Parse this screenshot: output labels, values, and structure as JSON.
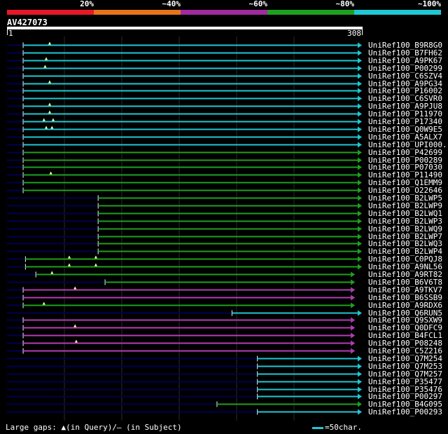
{
  "legend": {
    "labels": [
      "20%",
      "~40%",
      "~60%",
      "~80%",
      "~100%"
    ],
    "colors": [
      "#e8182a",
      "#e8741a",
      "#a02aa0",
      "#1ea01e",
      "#1ec8d2"
    ]
  },
  "query": {
    "name": "AV427073",
    "start": "1",
    "end": "308"
  },
  "colors": {
    "cyan": "#1ec8d2",
    "green": "#1ea01e",
    "magenta": "#b43cb4",
    "navy": "#000050",
    "gap_line": "#3a3a3a"
  },
  "hits": [
    {
      "name": "UniRef100_B9R8G0",
      "color": "cyan",
      "start": 15,
      "end": 308,
      "gaps": [
        38
      ]
    },
    {
      "name": "UniRef100_B7FH62",
      "color": "cyan",
      "start": 15,
      "end": 308,
      "gaps": []
    },
    {
      "name": "UniRef100_A9PK67",
      "color": "cyan",
      "start": 15,
      "end": 308,
      "gaps": [
        35
      ]
    },
    {
      "name": "UniRef100_P00299",
      "color": "cyan",
      "start": 15,
      "end": 308,
      "gaps": [
        34
      ]
    },
    {
      "name": "UniRef100_C6SZV4",
      "color": "cyan",
      "start": 15,
      "end": 308,
      "gaps": []
    },
    {
      "name": "UniRef100_A9PG34",
      "color": "cyan",
      "start": 15,
      "end": 308,
      "gaps": [
        38
      ]
    },
    {
      "name": "UniRef100_P16002",
      "color": "cyan",
      "start": 15,
      "end": 308,
      "gaps": []
    },
    {
      "name": "UniRef100_C6SVR0",
      "color": "cyan",
      "start": 15,
      "end": 308,
      "gaps": []
    },
    {
      "name": "UniRef100_A9PJU8",
      "color": "cyan",
      "start": 15,
      "end": 308,
      "gaps": [
        38
      ]
    },
    {
      "name": "UniRef100_P11970",
      "color": "cyan",
      "start": 15,
      "end": 308,
      "gaps": [
        38
      ]
    },
    {
      "name": "UniRef100_P17340",
      "color": "cyan",
      "start": 15,
      "end": 308,
      "gaps": [
        33,
        41
      ]
    },
    {
      "name": "UniRef100_Q0W9E5",
      "color": "cyan",
      "start": 15,
      "end": 308,
      "gaps": [
        35,
        40
      ]
    },
    {
      "name": "UniRef100_A5ALX7",
      "color": "cyan",
      "start": 15,
      "end": 308,
      "gaps": []
    },
    {
      "name": "UniRef100_UPI000...",
      "color": "cyan",
      "start": 15,
      "end": 308,
      "gaps": []
    },
    {
      "name": "UniRef100_P42699",
      "color": "green",
      "start": 15,
      "end": 308,
      "gaps": []
    },
    {
      "name": "UniRef100_P00289",
      "color": "green",
      "start": 15,
      "end": 308,
      "gaps": []
    },
    {
      "name": "UniRef100_P07030",
      "color": "green",
      "start": 15,
      "end": 308,
      "gaps": []
    },
    {
      "name": "UniRef100_P11490",
      "color": "green",
      "start": 15,
      "end": 308,
      "gaps": [
        39
      ]
    },
    {
      "name": "UniRef100_Q1EMM9",
      "color": "green",
      "start": 15,
      "end": 308,
      "gaps": []
    },
    {
      "name": "UniRef100_O22646",
      "color": "green",
      "start": 15,
      "end": 308,
      "gaps": []
    },
    {
      "name": "UniRef100_B2LWP5",
      "color": "green",
      "start": 80,
      "end": 308,
      "gaps": []
    },
    {
      "name": "UniRef100_B2LWP9",
      "color": "green",
      "start": 80,
      "end": 308,
      "gaps": []
    },
    {
      "name": "UniRef100_B2LWQ1",
      "color": "green",
      "start": 80,
      "end": 308,
      "gaps": []
    },
    {
      "name": "UniRef100_B2LWP3",
      "color": "green",
      "start": 80,
      "end": 308,
      "gaps": []
    },
    {
      "name": "UniRef100_B2LWQ9",
      "color": "green",
      "start": 80,
      "end": 308,
      "gaps": []
    },
    {
      "name": "UniRef100_B2LWP7",
      "color": "green",
      "start": 80,
      "end": 308,
      "gaps": []
    },
    {
      "name": "UniRef100_B2LWQ3",
      "color": "green",
      "start": 80,
      "end": 308,
      "gaps": []
    },
    {
      "name": "UniRef100_B2LWP4",
      "color": "green",
      "start": 80,
      "end": 308,
      "gaps": []
    },
    {
      "name": "UniRef100_C0PQJ8",
      "color": "green",
      "start": 17,
      "end": 308,
      "gaps": [
        55,
        78
      ]
    },
    {
      "name": "UniRef100_A9NL56",
      "color": "green",
      "start": 17,
      "end": 308,
      "gaps": [
        55,
        78
      ]
    },
    {
      "name": "UniRef100_A9RT82",
      "color": "green",
      "start": 26,
      "end": 302,
      "gaps": [
        40
      ]
    },
    {
      "name": "UniRef100_B6V6T8",
      "color": "green",
      "start": 86,
      "end": 302,
      "gaps": []
    },
    {
      "name": "UniRef100_A9TKV7",
      "color": "magenta",
      "start": 15,
      "end": 302,
      "gaps": [
        60
      ]
    },
    {
      "name": "UniRef100_B6SSB9",
      "color": "magenta",
      "start": 15,
      "end": 302,
      "gaps": []
    },
    {
      "name": "UniRef100_A9RDX6",
      "color": "green",
      "start": 15,
      "end": 302,
      "gaps": [
        33
      ]
    },
    {
      "name": "UniRef100_Q6RUN5",
      "color": "cyan",
      "start": 196,
      "end": 308,
      "gaps": []
    },
    {
      "name": "UniRef100_Q9SXW9",
      "color": "magenta",
      "start": 15,
      "end": 302,
      "gaps": []
    },
    {
      "name": "UniRef100_Q0DFC9",
      "color": "magenta",
      "start": 15,
      "end": 302,
      "gaps": [
        60
      ]
    },
    {
      "name": "UniRef100_B4FCL1",
      "color": "magenta",
      "start": 15,
      "end": 302,
      "gaps": []
    },
    {
      "name": "UniRef100_P08248",
      "color": "magenta",
      "start": 15,
      "end": 302,
      "gaps": [
        61
      ]
    },
    {
      "name": "UniRef100_C5Z216",
      "color": "magenta",
      "start": 15,
      "end": 302,
      "gaps": []
    },
    {
      "name": "UniRef100_Q7M254",
      "color": "cyan",
      "start": 218,
      "end": 308,
      "gaps": []
    },
    {
      "name": "UniRef100_Q7M253",
      "color": "cyan",
      "start": 218,
      "end": 308,
      "gaps": []
    },
    {
      "name": "UniRef100_Q7M257",
      "color": "cyan",
      "start": 218,
      "end": 308,
      "gaps": []
    },
    {
      "name": "UniRef100_P35477",
      "color": "cyan",
      "start": 218,
      "end": 308,
      "gaps": []
    },
    {
      "name": "UniRef100_P35476",
      "color": "cyan",
      "start": 218,
      "end": 308,
      "gaps": []
    },
    {
      "name": "UniRef100_P00297",
      "color": "cyan",
      "start": 218,
      "end": 308,
      "gaps": []
    },
    {
      "name": "UniRef100_B4G095",
      "color": "green",
      "start": 183,
      "end": 308,
      "gaps": []
    },
    {
      "name": "UniRef100_P00293",
      "color": "cyan",
      "start": 218,
      "end": 308,
      "gaps": []
    }
  ],
  "footer": {
    "text": "Large gaps: ▲(in Query)/– (in Subject)",
    "scale_label": "=50char."
  }
}
